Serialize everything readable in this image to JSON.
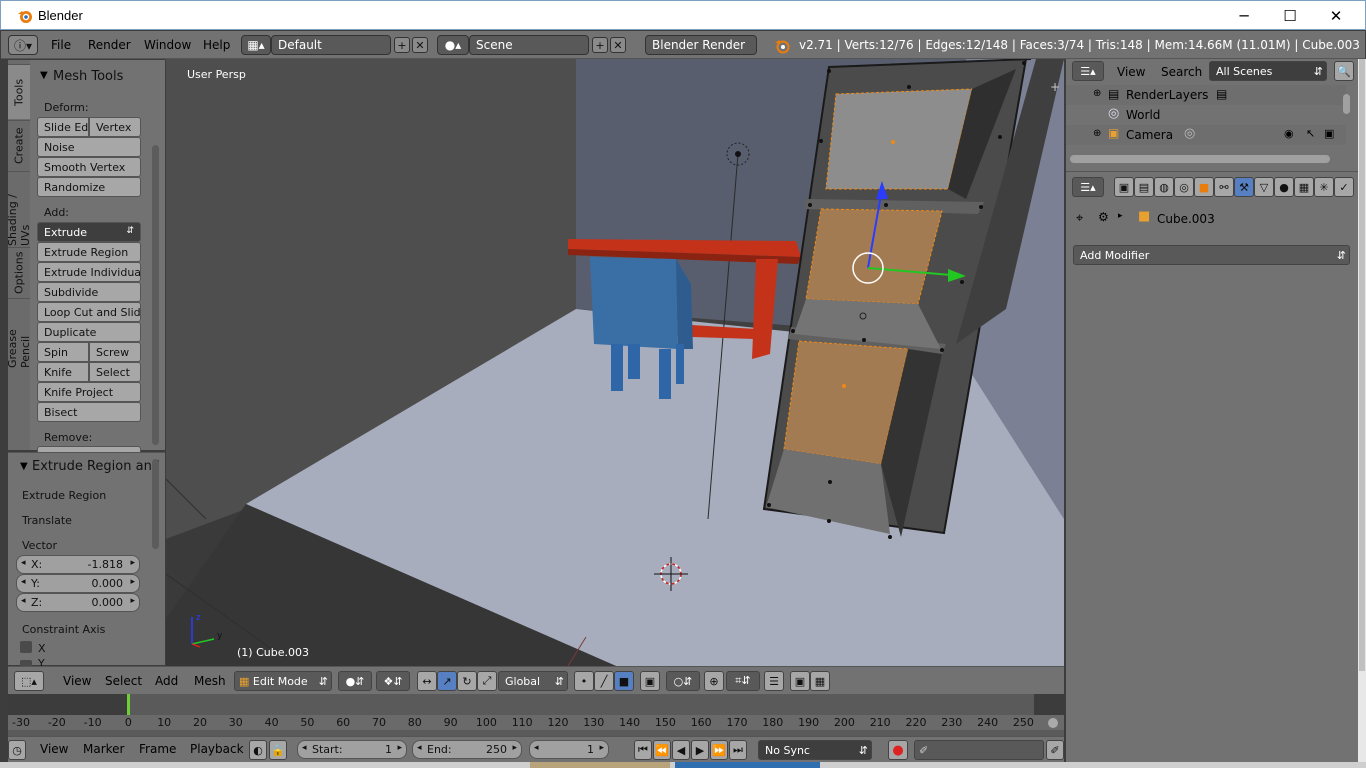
{
  "window": {
    "title": "Blender"
  },
  "info_header": {
    "menus": [
      "File",
      "Render",
      "Window",
      "Help"
    ],
    "screen_layout": "Default",
    "scene": "Scene",
    "render_engine": "Blender Render",
    "stats": "v2.71 | Verts:12/76 | Edges:12/148 | Faces:3/74 | Tris:148 | Mem:14.66M (11.01M) | Cube.003"
  },
  "tool_tabs": [
    "Tools",
    "Create",
    "Shading / UVs",
    "Options",
    "Grease Pencil"
  ],
  "mesh_tools": {
    "title": "Mesh Tools",
    "deform_label": "Deform:",
    "deform": [
      [
        "Slide Ed",
        "Vertex"
      ],
      [
        "Noise"
      ],
      [
        "Smooth Vertex"
      ],
      [
        "Randomize"
      ]
    ],
    "add_label": "Add:",
    "extrude": "Extrude",
    "add": [
      [
        "Extrude Region"
      ],
      [
        "Extrude Individual"
      ],
      [
        "Subdivide"
      ],
      [
        "Loop Cut and Slide"
      ],
      [
        "Duplicate"
      ],
      [
        "Spin",
        "Screw"
      ],
      [
        "Knife",
        "Select"
      ],
      [
        "Knife Project"
      ],
      [
        "Bisect"
      ]
    ],
    "remove_label": "Remove:"
  },
  "redo_panel": {
    "title": "Extrude Region and",
    "items": [
      "Extrude Region",
      "Translate"
    ],
    "vector_label": "Vector",
    "vector": [
      {
        "axis": "X:",
        "value": "-1.818"
      },
      {
        "axis": "Y:",
        "value": "0.000"
      },
      {
        "axis": "Z:",
        "value": "0.000"
      }
    ],
    "constraint_label": "Constraint Axis",
    "constraint_x": "X",
    "constraint_y": "Y"
  },
  "viewport": {
    "view_label": "User Persp",
    "object_label": "(1) Cube.003",
    "axis_labels": {
      "x": "x",
      "y": "y",
      "z": "z"
    }
  },
  "view3d_header": {
    "menus": [
      "View",
      "Select",
      "Add",
      "Mesh"
    ],
    "mode": "Edit Mode",
    "orientation": "Global"
  },
  "timeline": {
    "ticks": [
      "-30",
      "-20",
      "-10",
      "0",
      "10",
      "20",
      "30",
      "40",
      "50",
      "60",
      "70",
      "80",
      "90",
      "100",
      "110",
      "120",
      "130",
      "140",
      "150",
      "160",
      "170",
      "180",
      "190",
      "200",
      "210",
      "220",
      "230",
      "240",
      "250"
    ],
    "current_frame_pos": 0,
    "menus": [
      "View",
      "Marker",
      "Frame",
      "Playback"
    ],
    "start_label": "Start:",
    "start": "1",
    "end_label": "End:",
    "end": "250",
    "current": "1",
    "sync": "No Sync"
  },
  "outliner": {
    "menus": [
      "View",
      "Search"
    ],
    "filter": "All Scenes",
    "items": [
      "RenderLayers",
      "World",
      "Camera"
    ]
  },
  "properties": {
    "object": "Cube.003",
    "add_modifier": "Add Modifier"
  },
  "colors": {
    "accent": "#5680c2",
    "header": "#727272",
    "viewport_bg": "#404040",
    "selection": "#f08a12",
    "blender_orange": "#e87d0d"
  }
}
